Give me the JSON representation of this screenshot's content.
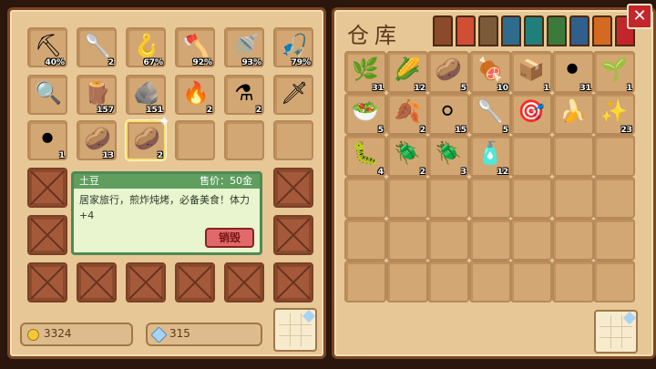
{
  "inventory": {
    "slots": [
      {
        "icon": "⛏",
        "qty": "40%"
      },
      {
        "icon": "🥄",
        "qty": "2"
      },
      {
        "icon": "🪝",
        "qty": "67%"
      },
      {
        "icon": "🪓",
        "qty": "92%"
      },
      {
        "icon": "🚿",
        "qty": "93%"
      },
      {
        "icon": "🎣",
        "qty": "79%"
      },
      {
        "icon": "🔍",
        "qty": ""
      },
      {
        "icon": "🪵",
        "qty": "157"
      },
      {
        "icon": "🪨",
        "qty": "151"
      },
      {
        "icon": "🔥",
        "qty": "2"
      },
      {
        "icon": "⚗",
        "qty": "2"
      },
      {
        "icon": "🗡",
        "qty": ""
      },
      {
        "icon": "⚫",
        "qty": "1"
      },
      {
        "icon": "🥔",
        "qty": "13"
      },
      {
        "icon": "🥔",
        "qty": "2"
      }
    ]
  },
  "tooltip": {
    "name": "土豆",
    "price": "售价：50金",
    "description": "居家旅行，煎炸炖烤，必备美食！体力+4",
    "destroy_label": "销毁"
  },
  "currency": {
    "gold": "3324",
    "gems": "315"
  },
  "storage": {
    "title": "仓库",
    "tab_colors": [
      "#8b4a2b",
      "#d14d33",
      "#7b5a3a",
      "#2f6b8c",
      "#1f7f7a",
      "#3b7a3b",
      "#2f5f8c",
      "#d46a1f",
      "#c2262b"
    ],
    "slots": [
      {
        "icon": "🌿",
        "qty": "31"
      },
      {
        "icon": "🌽",
        "qty": "12"
      },
      {
        "icon": "🥔",
        "qty": "5"
      },
      {
        "icon": "🍖",
        "qty": "10"
      },
      {
        "icon": "📦",
        "qty": "1"
      },
      {
        "icon": "⚫",
        "qty": "31"
      },
      {
        "icon": "🌱",
        "qty": "1"
      },
      {
        "icon": "🥗",
        "qty": "5"
      },
      {
        "icon": "🍂",
        "qty": "2"
      },
      {
        "icon": "⚪",
        "qty": "15"
      },
      {
        "icon": "🥄",
        "qty": "5"
      },
      {
        "icon": "🎯",
        "qty": ""
      },
      {
        "icon": "🍌",
        "qty": ""
      },
      {
        "icon": "✨",
        "qty": "23"
      },
      {
        "icon": "🐛",
        "qty": "4"
      },
      {
        "icon": "🪲",
        "qty": "2"
      },
      {
        "icon": "🪲",
        "qty": "3"
      },
      {
        "icon": "🧴",
        "qty": "12"
      }
    ]
  }
}
